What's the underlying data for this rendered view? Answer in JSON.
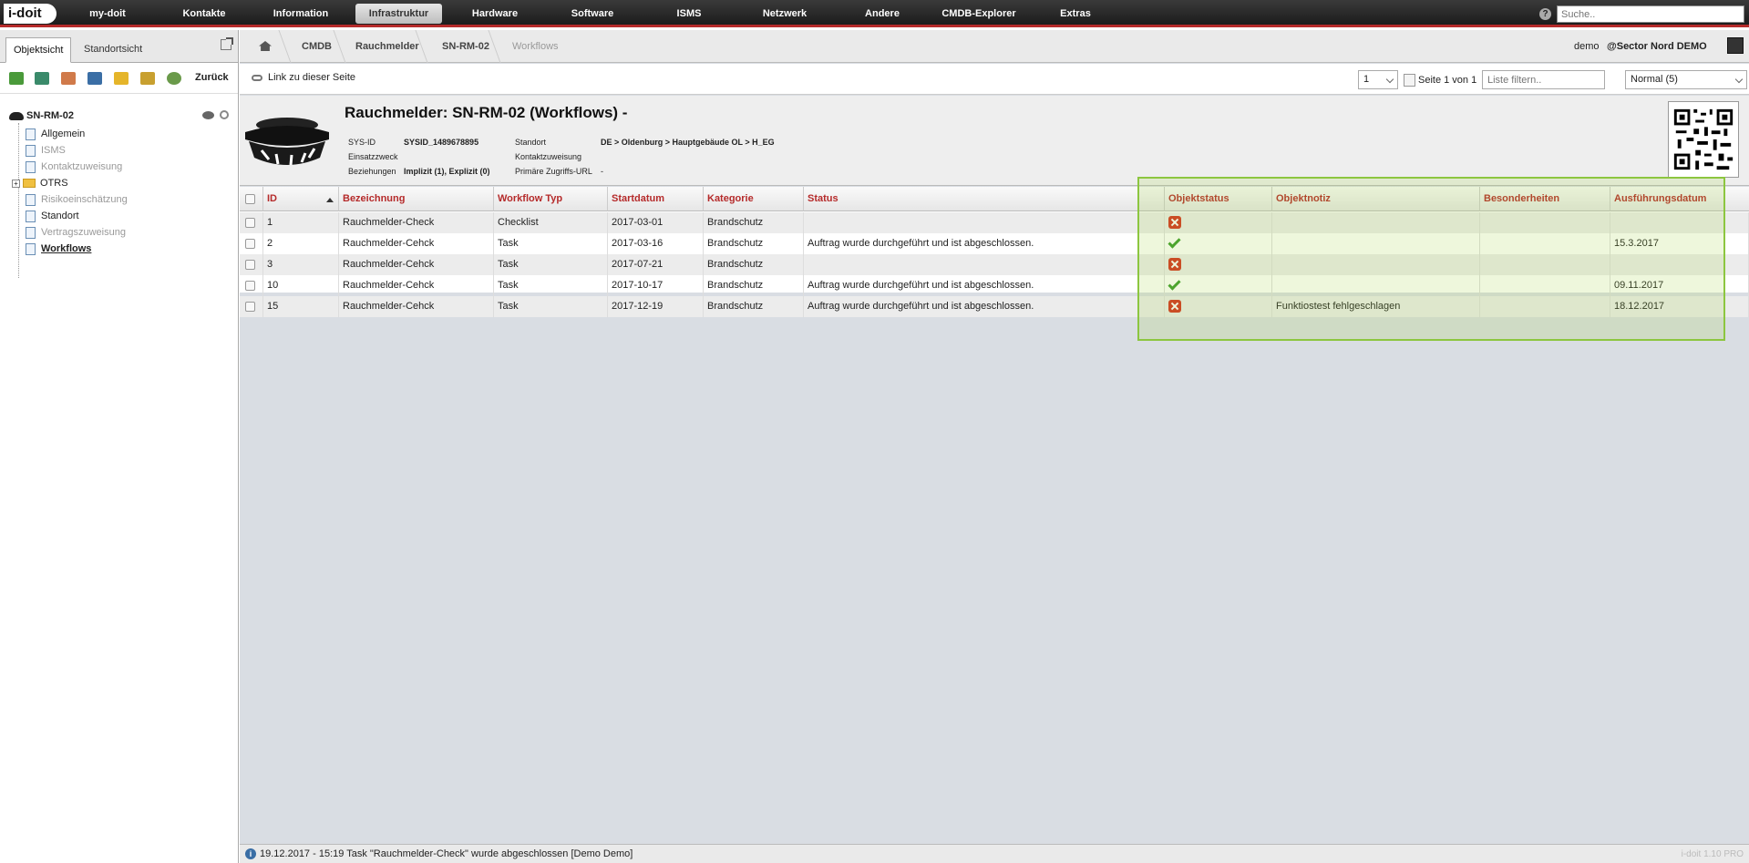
{
  "app": {
    "logo_text": "i-doit",
    "version": "i-doit 1.10 PRO"
  },
  "topnav": {
    "items": [
      {
        "label": "my-doit"
      },
      {
        "label": "Kontakte"
      },
      {
        "label": "Information"
      },
      {
        "label": "Infrastruktur",
        "active": true
      },
      {
        "label": "Hardware"
      },
      {
        "label": "Software"
      },
      {
        "label": "ISMS"
      },
      {
        "label": "Netzwerk"
      },
      {
        "label": "Andere"
      },
      {
        "label": "CMDB-Explorer"
      },
      {
        "label": "Extras"
      }
    ],
    "help_label": "?",
    "search_placeholder": "Suche.."
  },
  "left": {
    "tabs": [
      "Objektsicht",
      "Standortsicht"
    ],
    "back_label": "Zurück",
    "tree": {
      "root": "SN-RM-02",
      "items": [
        {
          "label": "Allgemein",
          "state": "normal"
        },
        {
          "label": "ISMS",
          "state": "disabled"
        },
        {
          "label": "Kontaktzuweisung",
          "state": "disabled"
        },
        {
          "label": "OTRS",
          "state": "folder"
        },
        {
          "label": "Risikoeinschätzung",
          "state": "disabled"
        },
        {
          "label": "Standort",
          "state": "normal"
        },
        {
          "label": "Vertragszuweisung",
          "state": "disabled"
        },
        {
          "label": "Workflows",
          "state": "active"
        }
      ]
    }
  },
  "breadcrumb": {
    "items": [
      "CMDB",
      "Rauchmelder",
      "SN-RM-02",
      "Workflows"
    ],
    "user": "demo",
    "tenant": "@Sector Nord DEMO"
  },
  "toolbar": {
    "link_label": "Link zu dieser Seite",
    "page_value": "1",
    "page_info": "Seite 1 von 1",
    "filter_placeholder": "Liste filtern..",
    "view_value": "Normal (5)"
  },
  "object": {
    "title": "Rauchmelder: SN-RM-02 (Workflows)    -",
    "sysid_label": "SYS-ID",
    "sysid_value": "SYSID_1489678895",
    "einsatz_label": "Einsatzzweck",
    "bez_label": "Beziehungen",
    "bez_value": "Implizit (1), Explizit (0)",
    "standort_label": "Standort",
    "standort_value": "DE > Oldenburg > Hauptgebäude OL > H_EG",
    "kontakt_label": "Kontaktzuweisung",
    "url_label": "Primäre Zugriffs-URL",
    "url_value": "-"
  },
  "table": {
    "headers": [
      "ID",
      "Bezeichnung",
      "Workflow Typ",
      "Startdatum",
      "Kategorie",
      "Status",
      "Objektstatus",
      "Objektnotiz",
      "Besonderheiten",
      "Ausführungsdatum"
    ],
    "rows": [
      {
        "id": "1",
        "bez": "Rauchmelder-Check",
        "typ": "Checklist",
        "start": "2017-03-01",
        "kat": "Brandschutz",
        "status": "",
        "objstatus": "error",
        "notiz": "",
        "bes": "",
        "datum": ""
      },
      {
        "id": "2",
        "bez": "Rauchmelder-Cehck",
        "typ": "Task",
        "start": "2017-03-16",
        "kat": "Brandschutz",
        "status": "Auftrag wurde durchgeführt und ist abgeschlossen.",
        "objstatus": "ok",
        "notiz": "",
        "bes": "",
        "datum": "15.3.2017"
      },
      {
        "id": "3",
        "bez": "Rauchmelder-Cehck",
        "typ": "Task",
        "start": "2017-07-21",
        "kat": "Brandschutz",
        "status": "",
        "objstatus": "error",
        "notiz": "",
        "bes": "",
        "datum": ""
      },
      {
        "id": "10",
        "bez": "Rauchmelder-Cehck",
        "typ": "Task",
        "start": "2017-10-17",
        "kat": "Brandschutz",
        "status": "Auftrag wurde durchgeführt und ist abgeschlossen.",
        "objstatus": "ok",
        "notiz": "",
        "bes": "",
        "datum": "09.11.2017"
      },
      {
        "id": "15",
        "bez": "Rauchmelder-Cehck",
        "typ": "Task",
        "start": "2017-12-19",
        "kat": "Brandschutz",
        "status": "Auftrag wurde durchgeführt und ist abgeschlossen.",
        "objstatus": "error",
        "notiz": "Funktiostest fehlgeschlagen",
        "bes": "",
        "datum": "18.12.2017"
      }
    ]
  },
  "statusbar": {
    "message": "19.12.2017 - 15:19 Task \"Rauchmelder-Check\" wurde abgeschlossen [Demo Demo]"
  },
  "colors": {
    "accent": "#b52a2a",
    "highlight": "#8cc63f"
  }
}
